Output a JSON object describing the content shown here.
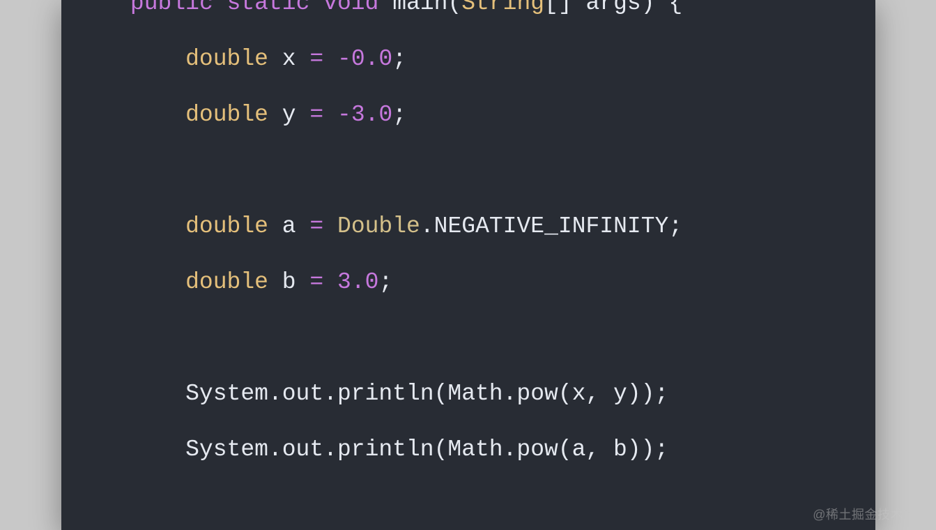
{
  "code": {
    "indent1": "   ",
    "indent2": "       ",
    "line0": {
      "k_public": "public",
      "sp": " ",
      "k_static": "static",
      "k_void": "void",
      "main": "main",
      "lparen": "(",
      "string": "String",
      "brackets": "[]",
      "args": "args",
      "rparen": ")",
      "brace": "{"
    },
    "line1": {
      "type": "double",
      "var": "x",
      "eq": "=",
      "minus": "-",
      "val": "0.0",
      "semi": ";"
    },
    "line2": {
      "type": "double",
      "var": "y",
      "eq": "=",
      "minus": "-",
      "val": "3.0",
      "semi": ";"
    },
    "line3": {
      "type": "double",
      "var": "a",
      "eq": "=",
      "cls": "Double",
      "dot": ".",
      "const": "NEGATIVE_INFINITY",
      "semi": ";"
    },
    "line4": {
      "type": "double",
      "var": "b",
      "eq": "=",
      "val": "3.0",
      "semi": ";"
    },
    "line5": {
      "text": "System.out.println(Math.pow(x, y));"
    },
    "line6": {
      "text": "System.out.println(Math.pow(a, b));"
    }
  },
  "watermark": "@稀土掘金技术社区"
}
